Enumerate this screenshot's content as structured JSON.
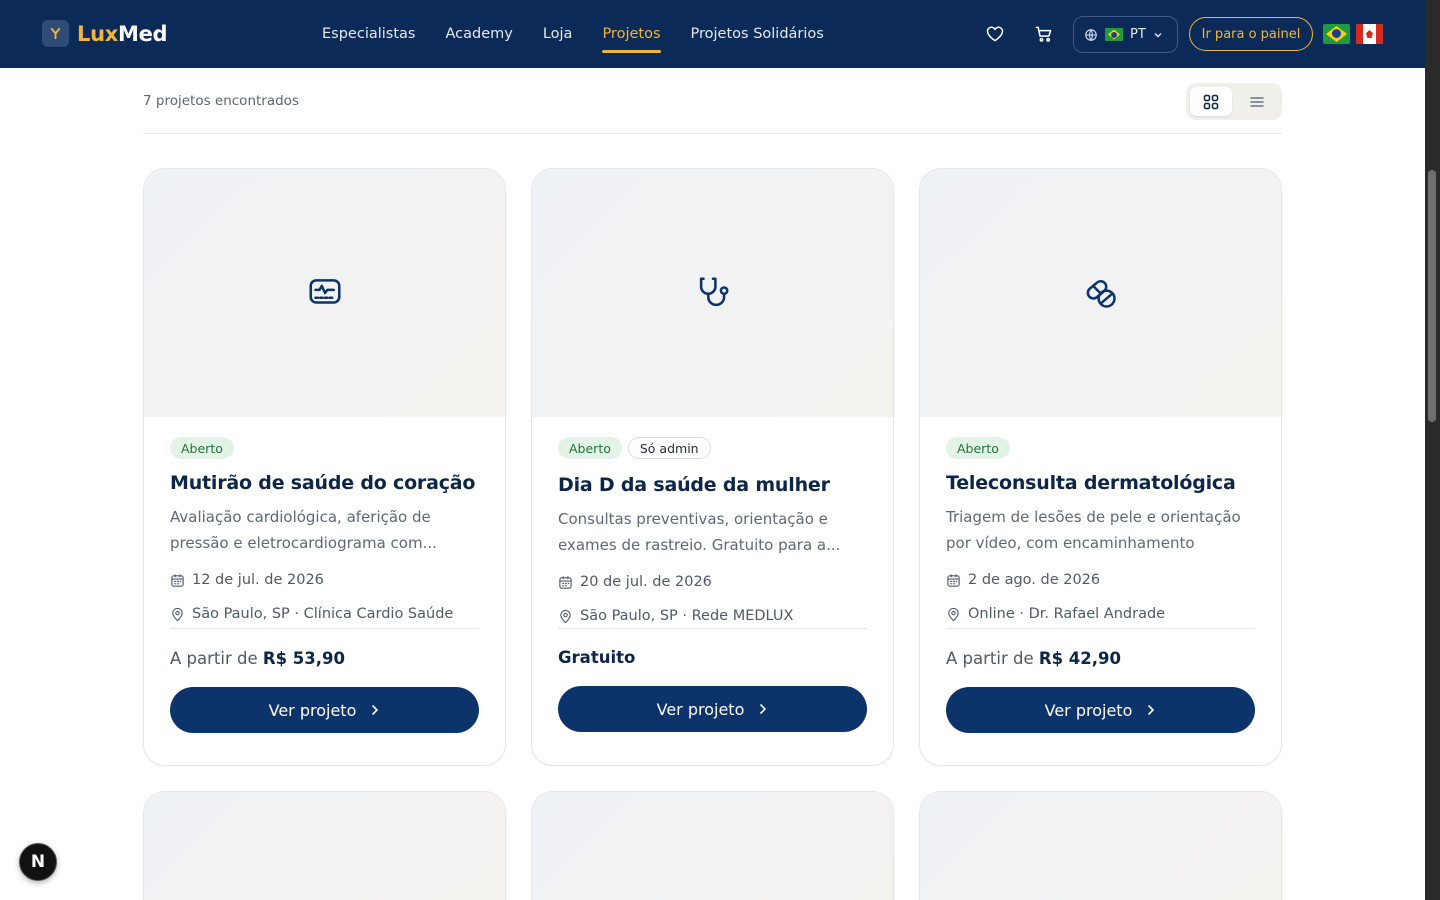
{
  "brand": {
    "part1": "Lux",
    "part2": "Med"
  },
  "nav": [
    {
      "label": "Especialistas",
      "active": false
    },
    {
      "label": "Academy",
      "active": false
    },
    {
      "label": "Loja",
      "active": false
    },
    {
      "label": "Projetos",
      "active": true
    },
    {
      "label": "Projetos Solidários",
      "active": false
    }
  ],
  "header": {
    "language": "PT",
    "panel_button": "Ir para o painel",
    "icons": [
      "heart-icon",
      "cart-icon",
      "globe-icon",
      "chevron-down-icon"
    ]
  },
  "toolbar": {
    "results": "7 projetos encontrados"
  },
  "cards": [
    {
      "badges": [
        "Aberto"
      ],
      "title": "Mutirão de saúde do coração",
      "description": "Avaliação cardiológica, aferição de pressão e eletrocardiograma com...",
      "date": "12 de jul. de 2026",
      "location": "São Paulo, SP · Clínica Cardio Saúde",
      "price_prefix": "A partir de ",
      "price_value": "R$ 53,90",
      "cta": "Ver projeto",
      "icon": "heart-monitor-icon"
    },
    {
      "badges": [
        "Aberto",
        "Só admin"
      ],
      "title": "Dia D da saúde da mulher",
      "description": "Consultas preventivas, orientação e exames de rastreio. Gratuito para a...",
      "date": "20 de jul. de 2026",
      "location": "São Paulo, SP · Rede MEDLUX",
      "price_prefix": "",
      "price_value": "Gratuito",
      "cta": "Ver projeto",
      "icon": "stethoscope-icon"
    },
    {
      "badges": [
        "Aberto"
      ],
      "title": "Teleconsulta dermatológica",
      "description": "Triagem de lesões de pele e orientação por vídeo, com encaminhamento quand...",
      "date": "2 de ago. de 2026",
      "location": "Online · Dr. Rafael Andrade",
      "price_prefix": "A partir de ",
      "price_value": "R$ 42,90",
      "cta": "Ver projeto",
      "icon": "pills-icon"
    }
  ],
  "colors": {
    "navy": "#0c2a57",
    "gold": "#f0b63a",
    "button": "#0c346b",
    "badge_green": "#23733b"
  }
}
